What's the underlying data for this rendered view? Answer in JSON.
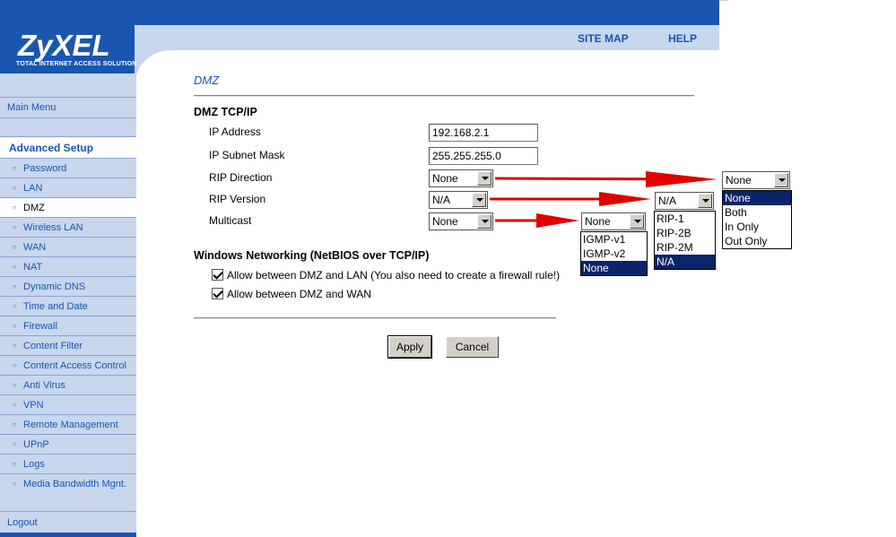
{
  "brand": {
    "logo": "ZyXEL",
    "tagline": "Total Internet Access Solution"
  },
  "top_links": {
    "site_map": "SITE MAP",
    "help": "HELP"
  },
  "sidebar": {
    "main_menu": "Main Menu",
    "section": "Advanced Setup",
    "items": [
      {
        "label": "Password"
      },
      {
        "label": "LAN"
      },
      {
        "label": "DMZ",
        "active": true
      },
      {
        "label": "Wireless LAN"
      },
      {
        "label": "WAN"
      },
      {
        "label": "NAT"
      },
      {
        "label": "Dynamic DNS"
      },
      {
        "label": "Time and Date"
      },
      {
        "label": "Firewall"
      },
      {
        "label": "Content Filter"
      },
      {
        "label": "Content Access Control"
      },
      {
        "label": "Anti Virus"
      },
      {
        "label": "VPN"
      },
      {
        "label": "Remote Management"
      },
      {
        "label": "UPnP"
      },
      {
        "label": "Logs"
      },
      {
        "label": "Media Bandwidth Mgnt."
      }
    ],
    "logout": "Logout"
  },
  "main": {
    "title": "DMZ",
    "tcpip_section": "DMZ TCP/IP",
    "ip_address": {
      "label": "IP Address",
      "value": "192.168.2.1"
    },
    "subnet_mask": {
      "label": "IP Subnet Mask",
      "value": "255.255.255.0"
    },
    "rip_direction": {
      "label": "RIP Direction",
      "value": "None",
      "options": [
        "None",
        "Both",
        "In Only",
        "Out Only"
      ]
    },
    "rip_version": {
      "label": "RIP Version",
      "value": "N/A",
      "options": [
        "RIP-1",
        "RIP-2B",
        "RIP-2M",
        "N/A"
      ]
    },
    "multicast": {
      "label": "Multicast",
      "value": "None",
      "options": [
        "IGMP-v1",
        "IGMP-v2",
        "None"
      ]
    },
    "netbios_section": "Windows Networking (NetBIOS over TCP/IP)",
    "allow_lan": {
      "label": "Allow between DMZ and LAN (You also need to create a firewall rule!)",
      "checked": true
    },
    "allow_wan": {
      "label": "Allow between DMZ and WAN",
      "checked": true
    },
    "apply": "Apply",
    "cancel": "Cancel"
  },
  "colors": {
    "brand_blue": "#1a56b0",
    "sidebar_bg": "#c8d6ee",
    "highlight": "#0a246a",
    "arrow": "#e00000"
  }
}
